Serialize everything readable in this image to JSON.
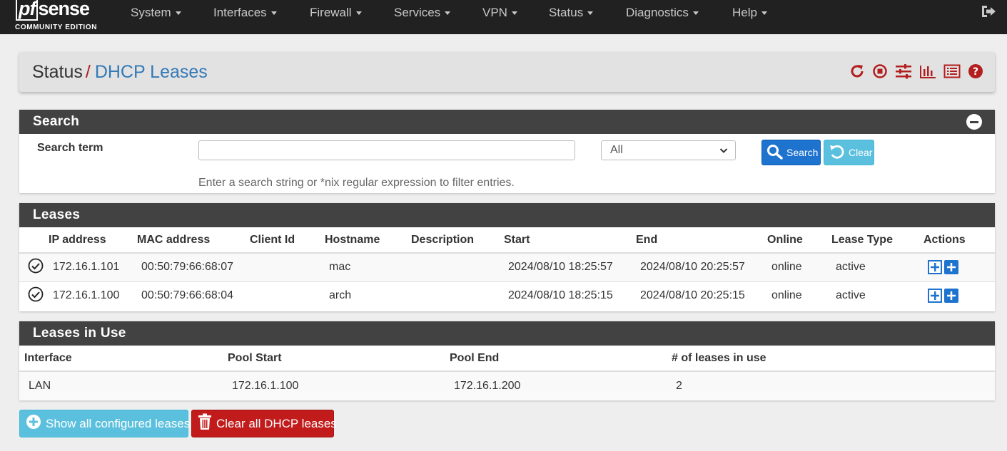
{
  "brand": {
    "logo_pf": "pf",
    "logo_sense": "sense",
    "sub": "COMMUNITY EDITION"
  },
  "nav": [
    {
      "label": "System"
    },
    {
      "label": "Interfaces"
    },
    {
      "label": "Firewall"
    },
    {
      "label": "Services"
    },
    {
      "label": "VPN"
    },
    {
      "label": "Status"
    },
    {
      "label": "Diagnostics"
    },
    {
      "label": "Help"
    }
  ],
  "header": {
    "crumb_parent": "Status",
    "crumb_sep": "/",
    "crumb_current": "DHCP Leases"
  },
  "search": {
    "title": "Search",
    "term_label": "Search term",
    "term_value": "",
    "select_value": "All",
    "search_button": "Search",
    "clear_button": "Clear",
    "help": "Enter a search string or *nix regular expression to filter entries."
  },
  "leases": {
    "title": "Leases",
    "columns": [
      "IP address",
      "MAC address",
      "Client Id",
      "Hostname",
      "Description",
      "Start",
      "End",
      "Online",
      "Lease Type",
      "Actions"
    ],
    "rows": [
      {
        "ip": "172.16.1.101",
        "mac": "00:50:79:66:68:07",
        "client_id": "",
        "hostname": "mac",
        "description": "",
        "start": "2024/08/10 18:25:57",
        "end": "2024/08/10 20:25:57",
        "online": "online",
        "type": "active"
      },
      {
        "ip": "172.16.1.100",
        "mac": "00:50:79:66:68:04",
        "client_id": "",
        "hostname": "arch",
        "description": "",
        "start": "2024/08/10 18:25:15",
        "end": "2024/08/10 20:25:15",
        "online": "online",
        "type": "active"
      }
    ]
  },
  "inuse": {
    "title": "Leases in Use",
    "columns": [
      "Interface",
      "Pool Start",
      "Pool End",
      "# of leases in use"
    ],
    "rows": [
      {
        "interface": "LAN",
        "pool_start": "172.16.1.100",
        "pool_end": "172.16.1.200",
        "count": "2"
      }
    ]
  },
  "buttons": {
    "show_all": "Show all configured leases",
    "clear_all": "Clear all DHCP leases"
  },
  "colors": {
    "navbar": "#212121",
    "panel_head": "#424242",
    "accent_red": "#b31e1e",
    "link_blue": "#337ab7",
    "btn_primary": "#1e73cf",
    "btn_info": "#5bc0de",
    "btn_danger": "#c11b1b"
  }
}
